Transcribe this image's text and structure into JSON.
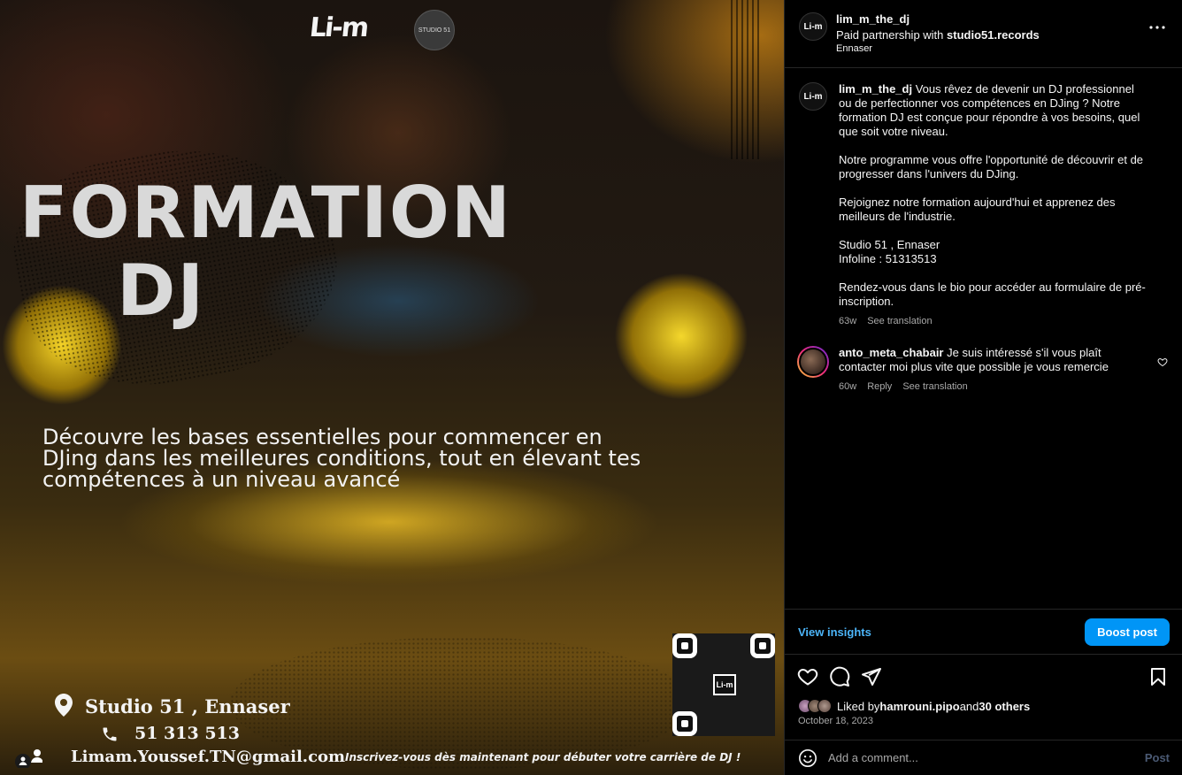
{
  "image": {
    "logo_text": "Li-m",
    "studio_logo_text": "STUDIO 51",
    "headline_line1": "FORMATION",
    "headline_line2": "DJ",
    "subtext": "Découvre les bases essentielles pour commencer en DJing dans les meilleures conditions, tout en élevant tes compétences à un niveau avancé",
    "address": "Studio 51 , Ennaser",
    "phone": "51 313 513",
    "email": "Limam.Youssef.TN@gmail.com",
    "cta": "Inscrivez-vous dès maintenant pour débuter votre carrière de DJ !",
    "qr_center": "Li-m"
  },
  "header": {
    "avatar_text": "Li-m",
    "username": "lim_m_the_dj",
    "partnership_prefix": "Paid partnership with ",
    "partner": "studio51.records",
    "location": "Ennaser"
  },
  "caption": {
    "username": "lim_m_the_dj",
    "p1": "Vous rêvez de devenir un DJ professionnel ou de perfectionner vos compétences en DJing ? Notre formation DJ est conçue pour répondre à vos besoins, quel que soit votre niveau.",
    "p2": "Notre programme vous offre l'opportunité de découvrir et de progresser dans l'univers du DJing.",
    "p3": "Rejoignez notre formation aujourd'hui et apprenez des meilleurs de l'industrie.",
    "p4a": "Studio 51 , Ennaser",
    "p4b": "Infoline : 51313513",
    "p5": "Rendez-vous dans le bio pour accéder au formulaire de pré-inscription.",
    "age": "63w",
    "see_translation": "See translation"
  },
  "comment": {
    "username": "anto_meta_chabair",
    "text": "Je suis intéressé s'il vous plaît contacter moi plus vite que possible je vous remercie",
    "age": "60w",
    "reply": "Reply",
    "see_translation": "See translation"
  },
  "insights": {
    "view_insights": "View insights",
    "boost_post": "Boost post"
  },
  "likes": {
    "prefix": "Liked by ",
    "user": "hamrouni.pipo",
    "middle": " and ",
    "others": "30 others"
  },
  "date": "October 18, 2023",
  "add_comment": {
    "placeholder": "Add a comment...",
    "post_label": "Post"
  },
  "colors": {
    "accent_blue": "#0095f6",
    "link_blue": "#4cb5f9",
    "background": "#000000",
    "muted_text": "#a8a8a8"
  },
  "icons": [
    "location-pin-icon",
    "phone-icon",
    "tag-people-icon",
    "more-options-icon",
    "heart-icon",
    "comment-icon",
    "share-icon",
    "save-icon",
    "emoji-icon"
  ]
}
